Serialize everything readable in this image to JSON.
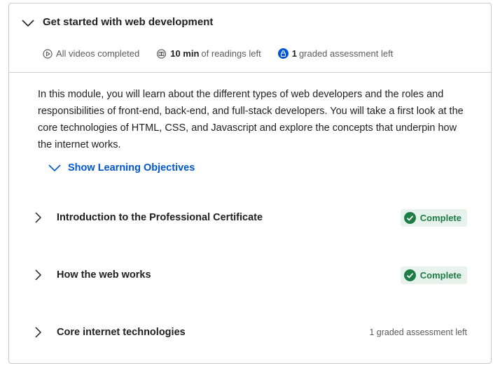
{
  "module": {
    "title": "Get started with web development",
    "meta": {
      "videos_text": "All videos completed",
      "readings_bold": "10 min",
      "readings_text": "of readings left",
      "assessment_bold": "1",
      "assessment_text": "graded assessment left"
    },
    "description": "In this module, you will learn about the different types of web developers and the roles and responsibilities of front-end, back-end, and full-stack developers. You will take a first look at the core technologies of HTML, CSS, and Javascript and explore the concepts that underpin how the internet works.",
    "objectives_label": "Show Learning Objectives"
  },
  "lessons": [
    {
      "title": "Introduction to the Professional Certificate",
      "status": "Complete"
    },
    {
      "title": "How the web works",
      "status": "Complete"
    },
    {
      "title": "Core internet technologies",
      "note": "1 graded assessment left"
    }
  ],
  "colors": {
    "accent": "#0056d2",
    "complete_green": "#1e7d45",
    "complete_bg": "#e8f2ec"
  }
}
